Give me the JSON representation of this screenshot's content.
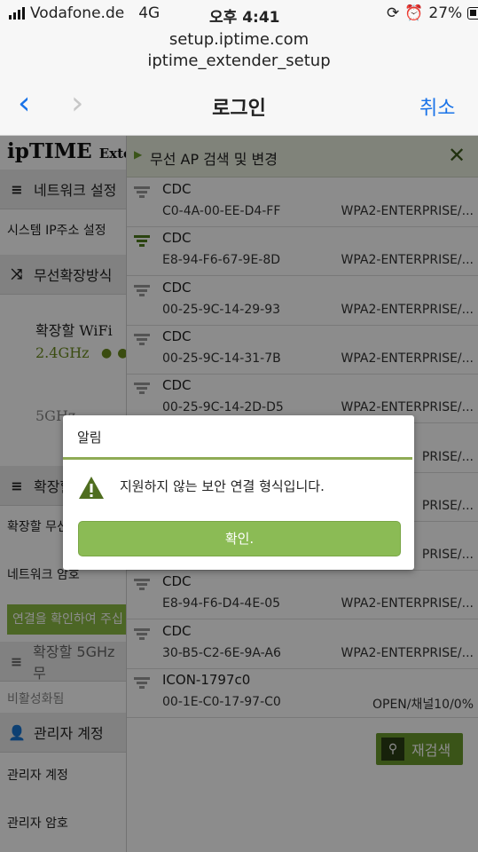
{
  "status_bar": {
    "carrier": "Vodafone.de",
    "network": "4G",
    "time": "오후 4:41",
    "battery": "27%"
  },
  "header": {
    "url_line1": "setup.iptime.com",
    "url_line2": "iptime_extender_setup",
    "back_icon": "‹",
    "forward_icon": "›",
    "title": "로그인",
    "cancel": "취소"
  },
  "logo": {
    "ip": "ip",
    "time": "TIME",
    "extender": "Extend"
  },
  "sidebar": {
    "network_settings": "네트워크 설정",
    "system_ip": "시스템 IP주소 설정",
    "extension_mode": "무선확장방식",
    "extend_wifi": "확장할 WiFi",
    "band_24": "2.4GHz",
    "band_5": "5GHz",
    "extend_section": "확장할",
    "extend_item": "확장할 무선",
    "network_password": "네트워크 암호",
    "confirm_button": "연결을 확인하여 주십",
    "extend_5ghz": "확장할 5GHz 무",
    "disabled": "비활성화됨",
    "admin_account_header": "관리자 계정",
    "admin_account": "관리자 계정",
    "admin_password": "관리자 암호"
  },
  "wifi_panel": {
    "title": "무선 AP 검색 및 변경",
    "close_icon": "✕",
    "rows": [
      {
        "ssid": "CDC",
        "mac": "C0-4A-00-EE-D4-FF",
        "security": "WPA2-ENTERPRISE/..."
      },
      {
        "ssid": "CDC",
        "mac": "E8-94-F6-67-9E-8D",
        "security": "WPA2-ENTERPRISE/..."
      },
      {
        "ssid": "CDC",
        "mac": "00-25-9C-14-29-93",
        "security": "WPA2-ENTERPRISE/..."
      },
      {
        "ssid": "CDC",
        "mac": "00-25-9C-14-31-7B",
        "security": "WPA2-ENTERPRISE/..."
      },
      {
        "ssid": "CDC",
        "mac": "00-25-9C-14-2D-D5",
        "security": "WPA2-ENTERPRISE/..."
      },
      {
        "ssid": "",
        "mac": "",
        "security": "PRISE/..."
      },
      {
        "ssid": "",
        "mac": "",
        "security": "PRISE/..."
      },
      {
        "ssid": "",
        "mac": "",
        "security": "PRISE/..."
      },
      {
        "ssid": "CDC",
        "mac": "E8-94-F6-D4-4E-05",
        "security": "WPA2-ENTERPRISE/..."
      },
      {
        "ssid": "CDC",
        "mac": "30-B5-C2-6E-9A-A6",
        "security": "WPA2-ENTERPRISE/..."
      },
      {
        "ssid": "ICON-1797c0",
        "mac": "00-1E-C0-17-97-C0",
        "security": "OPEN/채널10/0%"
      }
    ],
    "rescan": "재검색"
  },
  "dialog": {
    "title": "알림",
    "message": "지원하지 않는 보안 연결 형식입니다.",
    "ok": "확인."
  },
  "colors": {
    "ios_blue": "#1a73e8",
    "iptime_green": "#8bbb44",
    "dialog_rule": "#8fab55"
  }
}
